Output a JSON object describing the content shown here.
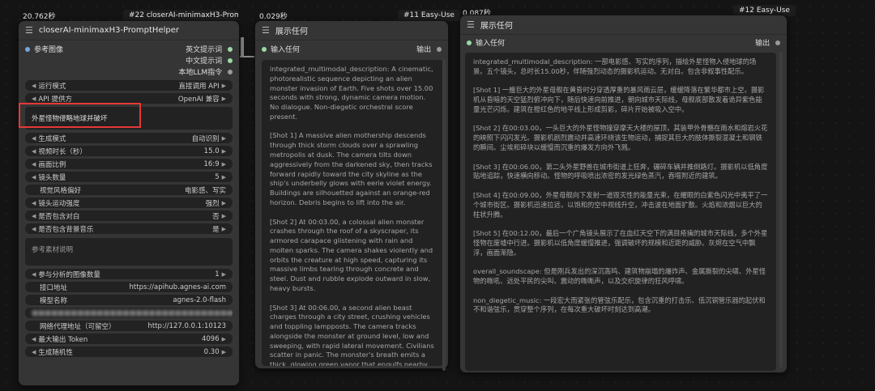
{
  "node1": {
    "time": "20.762秒",
    "badge": "#22 closerAI-minimaxH3-Promp...",
    "title": "closerAI-minimaxH3-PromptHelper",
    "input_label": "参考图像",
    "outputs": [
      "英文提示词",
      "中文提示词",
      "本地LLM指令"
    ],
    "widgets_a": [
      {
        "label": "运行模式",
        "value": "直接调用 API"
      },
      {
        "label": "API 提供方",
        "value": "OpenAI 兼容"
      }
    ],
    "prompt_text": "外星怪物侵略地球并破坏",
    "widgets_b": [
      {
        "label": "生成模式",
        "value": "自动识别"
      },
      {
        "label": "视频时长（秒）",
        "value": "15.0"
      },
      {
        "label": "画面比例",
        "value": "16:9"
      },
      {
        "label": "镜头数量",
        "value": "5"
      },
      {
        "label": "视觉风格偏好",
        "value": "电影感、写实"
      },
      {
        "label": "镜头运动强度",
        "value": "强烈"
      },
      {
        "label": "是否包含对白",
        "value": "否"
      },
      {
        "label": "是否包含背景音乐",
        "value": "是"
      }
    ],
    "ref_desc_placeholder": "参考素材说明",
    "widgets_c": [
      {
        "label": "参与分析的图像数量",
        "value": "1"
      },
      {
        "label": "接口地址",
        "value": "https://apihub.agnes-ai.com"
      },
      {
        "label": "模型名称",
        "value": "agnes-2.0-flash"
      },
      {
        "label": "网络代理地址（可留空）",
        "value": "http://127.0.0.1:10123"
      },
      {
        "label": "最大输出 Token",
        "value": "4096"
      },
      {
        "label": "生成随机性",
        "value": "0.30"
      }
    ]
  },
  "node2": {
    "time": "0.029秒",
    "badge": "#11 Easy-Use",
    "title": "展示任何",
    "input_label": "输入任何",
    "output_label": "输出",
    "text": "integrated_multimodal_description: A cinematic, photorealistic sequence depicting an alien monster invasion of Earth. Five shots over 15.00 seconds with strong, dynamic camera motion. No dialogue. Non-diegetic orchestral score present.\n\n[Shot 1] A massive alien mothership descends through thick storm clouds over a sprawling metropolis at dusk. The camera tilts down aggressively from the darkened sky, then tracks forward rapidly toward the city skyline as the ship's underbelly glows with eerie violet energy. Buildings are silhouetted against an orange-red horizon. Debris begins to lift into the air.\n\n[Shot 2] At 00:03.00, a colossal alien monster crashes through the roof of a skyscraper, its armored carapace glistening with rain and molten sparks. The camera shakes violently and orbits the creature at high speed, capturing its massive limbs tearing through concrete and steel. Dust and rubble explode outward in slow, heavy bursts.\n\n[Shot 3] At 00:06.00, a second alien beast charges through a city street, crushing vehicles and toppling lampposts. The camera tracks alongside the monster at ground level, low and sweeping, with rapid lateral movement. Civilians scatter in panic. The monster's breath emits a thick, glowing green vapor that engulfs nearby buildings."
  },
  "node3": {
    "time": "0.087秒",
    "badge": "#12 Easy-Use",
    "title": "展示任何",
    "input_label": "输入任何",
    "output_label": "输出",
    "text": "integrated_multimodal_description: 一部电影感、写实的序列，描绘外星怪物入侵地球的场景。五个镜头，总时长15.00秒，伴随强烈动态的摄影机运动。无对白。包含非叙事性配乐。\n\n[Shot 1] 一艘巨大的外星母舰在黄昏时分穿透厚重的暴风雨云层，缓缓降落在繁华都市上空。摄影机从昏暗的天空猛烈俯冲向下，随后快速向前推进，朝向城市天际线，母舰底部散发着诡异紫色能量光芒闪烁。建筑在橙红色的地平线上形成剪影，碎片开始被吸入空中。\n\n[Shot 2] 在00:03.00，一头巨大的外星怪物撞穿摩天大楼的屋顶，其装甲外骨骼在雨水和熔岩火花的映照下闪闪发光。摄影机剧烈震动并高速环绕该生物运动，捕捉其巨大的肢体撕裂混凝土和钢铁的瞬间。尘埃和碎块以缓慢而沉重的爆发方向外飞溅。\n\n[Shot 3] 在00:06.00，第二头外星野兽在城市街道上狂奔，碾碎车辆并推倒路灯。摄影机以低角度贴地追踪，快速横向移动。怪物的呼吸喷出浓密的发光绿色蒸汽，吞噬附近的建筑。\n\n[Shot 4] 在00:09.00，外星母舰向下发射一道毁灭性的能量光束，在耀眼的白紫色闪光中夷平了一个城市街区。摄影机迅速拉远，以饱和的空中视线升空，冲击波在地面扩散。火焰和浓烟以巨大的柱状升腾。\n\n[Shot 5] 在00:12.00，最后一个广角镜头展示了在血红天空下的满目疮痍的城市天际线，多个外星怪物在废墟中行进。摄影机以低角度缓慢推进，强调破坏的规模和近距的威胁。灰烬在空气中飘浮，画面渐隐。\n\noverall_soundscape: 但是刚兵发出的深沉轰鸣、建筑物崩塌的爆炸声、金属撕裂的尖啸、外星怪物的嘶吼、远处平民的尖叫、震动的嘶嘶声，以及交织旋律的狂风呼啸。\n\nnon_diegetic_music: 一段宏大而紧张的管弦乐配乐，包含沉重的打击乐、低沉铜管乐器的起伏和不和谐弦乐，贯穿整个序列，在每次重大破坏时刻达到高潮。"
  }
}
